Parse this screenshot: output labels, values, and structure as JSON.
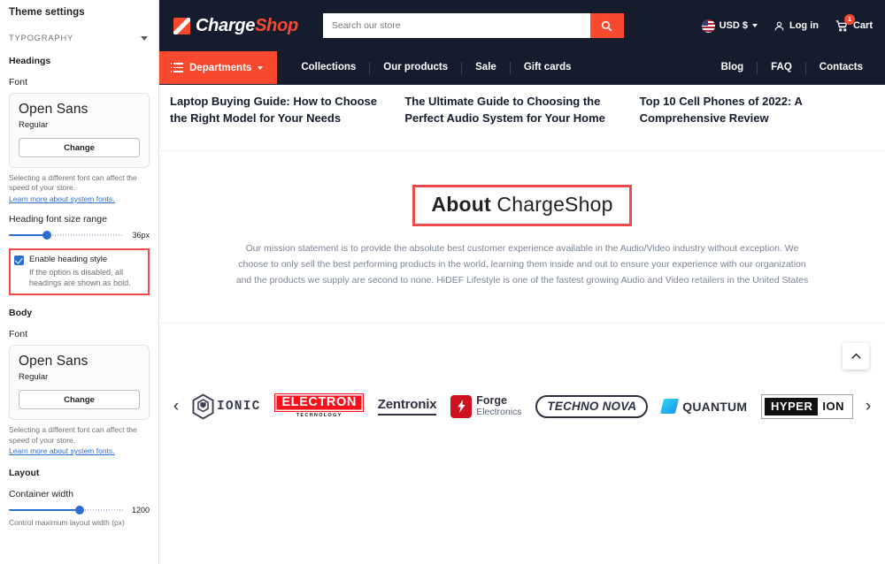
{
  "sidebar": {
    "title": "Theme settings",
    "section": {
      "label": "TYPOGRAPHY",
      "chevron_icon": "chevron-down-icon"
    },
    "headings": {
      "group_label": "Headings",
      "font_label": "Font",
      "font_name": "Open Sans",
      "font_weight": "Regular",
      "change_label": "Change",
      "help_text": "Selecting a different font can affect the speed of your store.",
      "help_link": "Learn more about system fonts.",
      "size_range_label": "Heading font size range",
      "size_range_value": "36px",
      "size_range_percent": 33
    },
    "heading_style": {
      "checkbox_label": "Enable heading style",
      "checkbox_checked": true,
      "help_text": "If the option is disabled, all headings are shown as bold.",
      "highlight_color": "#f0494a"
    },
    "body": {
      "group_label": "Body",
      "font_label": "Font",
      "font_name": "Open Sans",
      "font_weight": "Regular",
      "change_label": "Change",
      "help_text": "Selecting a different font can affect the speed of your store.",
      "help_link": "Learn more about system fonts."
    },
    "layout": {
      "group_label": "Layout",
      "container_width_label": "Container width",
      "container_width_value": "1200",
      "container_width_percent": 62,
      "container_width_help": "Control maximum layout width (px)"
    },
    "accent_color": "#2c6ecb"
  },
  "store": {
    "brand": {
      "name_first": "Charge",
      "name_second": "Shop",
      "logo_icon": "chargeshop-logo-icon"
    },
    "search": {
      "placeholder": "Search our store",
      "value": "",
      "button_icon": "search-icon"
    },
    "currency": {
      "label": "USD $",
      "flag_icon": "us-flag-icon",
      "chevron_icon": "chevron-down-icon"
    },
    "account": {
      "label": "Log in",
      "icon": "user-icon"
    },
    "cart": {
      "label": "Cart",
      "icon": "cart-icon",
      "count": "1"
    },
    "nav": {
      "departments": {
        "label": "Departments",
        "menu_icon": "list-icon",
        "chevron_icon": "chevron-down-icon"
      },
      "left_links": [
        "Collections",
        "Our products",
        "Sale",
        "Gift cards"
      ],
      "right_links": [
        "Blog",
        "FAQ",
        "Contacts"
      ],
      "accent_color": "#f8482e",
      "bar_color": "#141c2e"
    },
    "blog_strip": [
      "Laptop Buying Guide: How to Choose the Right Model for Your Needs",
      "The Ultimate Guide to Choosing the Perfect Audio System for Your Home",
      "Top 10 Cell Phones of 2022: A Comprehensive Review"
    ],
    "about": {
      "title_bold": "About",
      "title_regular": "ChargeShop",
      "highlight_color": "#f0494a",
      "body": "Our mission statement is to provide the absolute best customer experience available in the Audio/Video industry without exception. We choose to only sell the best performing products in the world, learning them inside and out to ensure your experience with our organization and the products we supply are second to none. HiDEF Lifestyle is one of the fastest growing Audio and Video retailers in the United States"
    },
    "brands": {
      "prev_icon": "chevron-left-icon",
      "next_icon": "chevron-right-icon",
      "items": [
        {
          "id": "ionic",
          "name": "IONIC"
        },
        {
          "id": "electron",
          "name": "ELECTRON",
          "subtitle": "TECHNOLOGY"
        },
        {
          "id": "zentronix",
          "name": "Zentronix"
        },
        {
          "id": "forge",
          "name": "Forge",
          "subtitle": "Electronics"
        },
        {
          "id": "techno-nova",
          "name": "TECHNO NOVA"
        },
        {
          "id": "quantum",
          "name": "QUANTUM"
        },
        {
          "id": "hyperion",
          "name": "HYPER",
          "name2": "ION"
        }
      ]
    },
    "scroll_top": {
      "icon": "chevron-up-icon",
      "label": ""
    }
  }
}
